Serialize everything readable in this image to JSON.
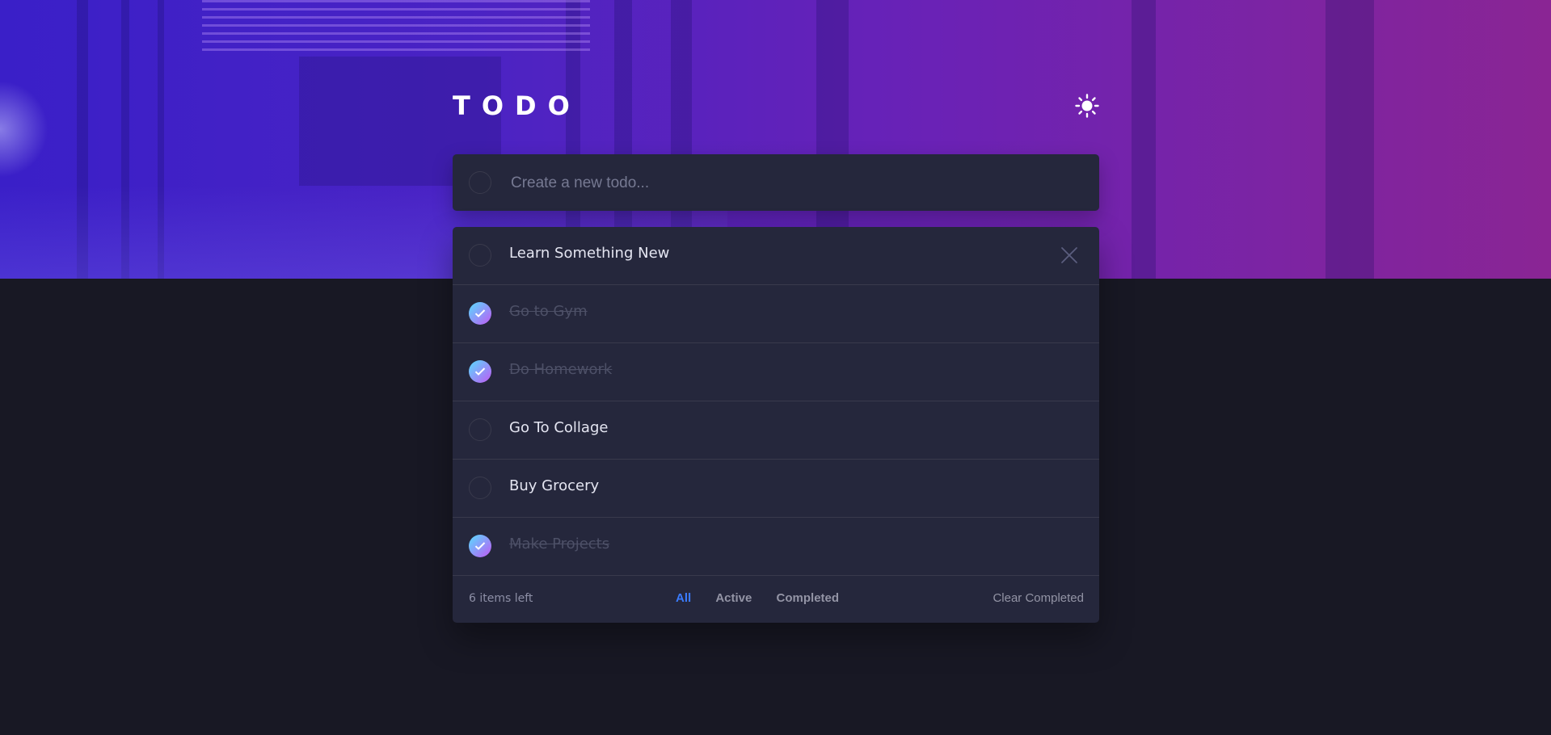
{
  "app": {
    "title": "TODO",
    "theme_icon": "sun-icon"
  },
  "new_todo": {
    "placeholder": "Create a new todo...",
    "value": ""
  },
  "todos": [
    {
      "text": "Learn Something New",
      "completed": false
    },
    {
      "text": "Go to Gym",
      "completed": true
    },
    {
      "text": "Do Homework",
      "completed": true
    },
    {
      "text": "Go To Collage",
      "completed": false
    },
    {
      "text": "Buy Grocery",
      "completed": false
    },
    {
      "text": "Make Projects",
      "completed": true
    }
  ],
  "footer": {
    "items_left": "6 items left",
    "filters": [
      "All",
      "Active",
      "Completed"
    ],
    "active_filter": "All",
    "clear_label": "Clear Completed"
  },
  "colors": {
    "background": "#181824",
    "card": "#25273c",
    "active_filter": "#3a7bfd",
    "check_gradient_start": "#57ddff",
    "check_gradient_end": "#c058f3"
  }
}
